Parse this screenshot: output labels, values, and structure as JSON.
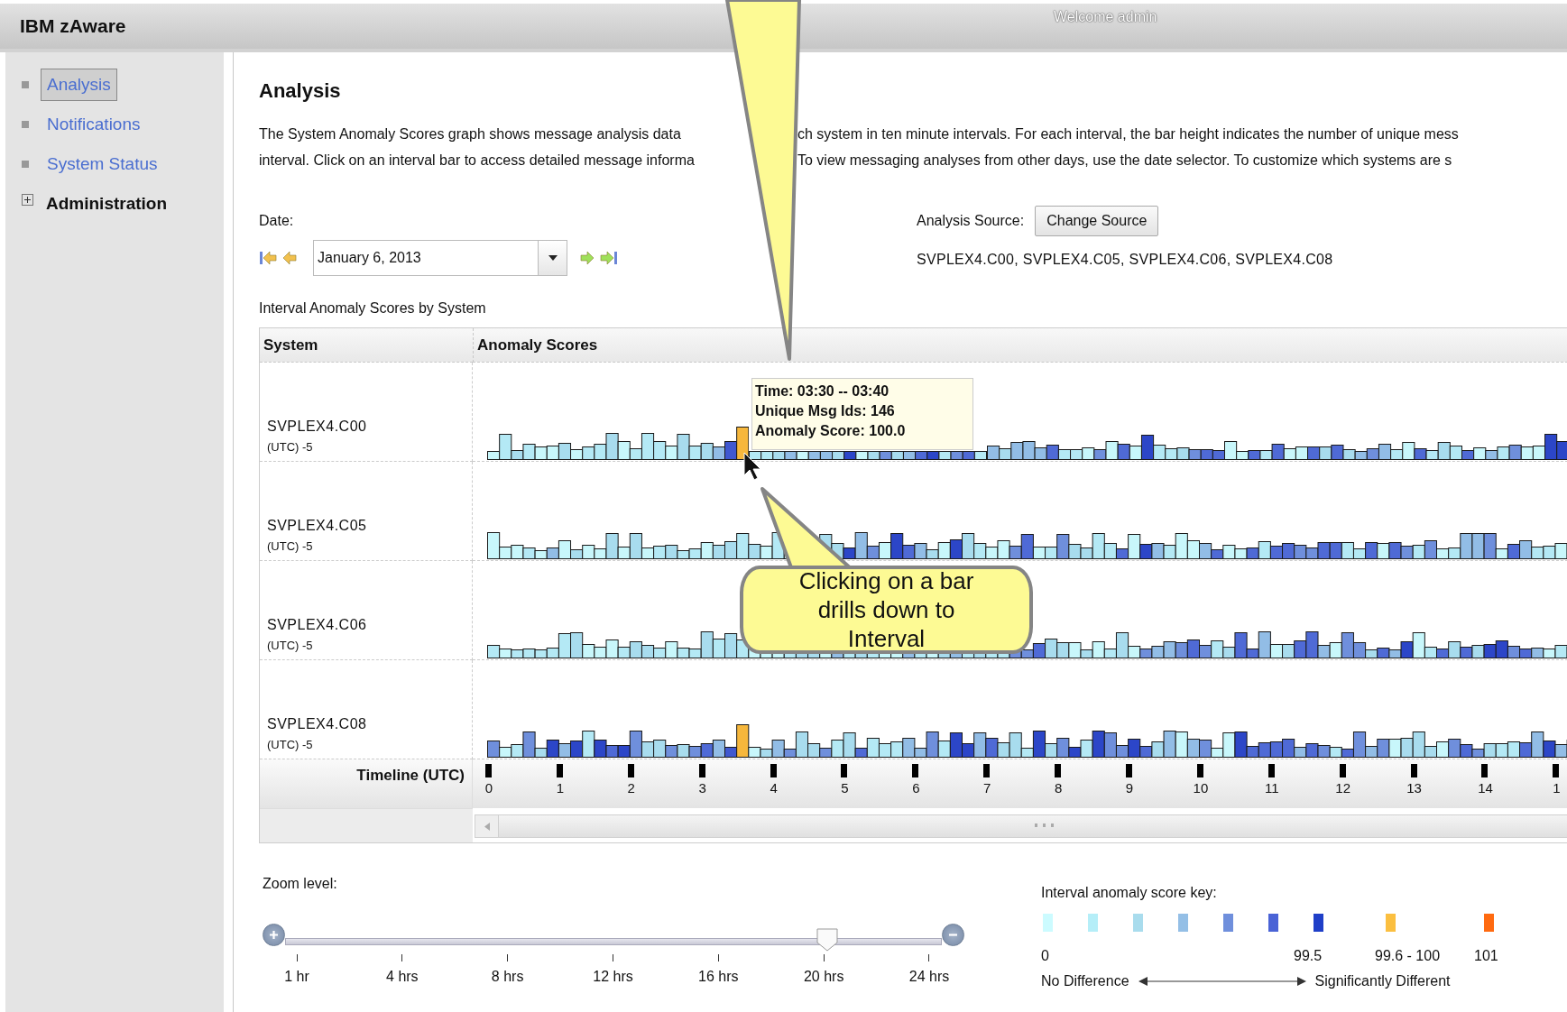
{
  "header": {
    "product": "IBM zAware",
    "welcome": "Welcome admin"
  },
  "sidebar": {
    "items": [
      {
        "label": "Analysis",
        "kind": "link",
        "selected": true
      },
      {
        "label": "Notifications",
        "kind": "link",
        "selected": false
      },
      {
        "label": "System Status",
        "kind": "link",
        "selected": false
      },
      {
        "label": "Administration",
        "kind": "group",
        "selected": false,
        "expanded": false
      }
    ]
  },
  "page": {
    "title": "Analysis",
    "description_lines": [
      {
        "before": "The System Anomaly Scores graph shows message analysis data",
        "after": "ch system in ten minute intervals. For each interval, the bar height indicates the number of unique mess"
      },
      {
        "before": "interval. Click on an interval bar to access detailed message informa",
        "after": "To view messaging analyses from other days, use the date selector. To customize which systems are s"
      }
    ]
  },
  "date": {
    "label": "Date:",
    "value": "January 6, 2013"
  },
  "source": {
    "label": "Analysis Source:",
    "button": "Change Source",
    "systems": "SVPLEX4.C00, SVPLEX4.C05, SVPLEX4.C06, SVPLEX4.C08"
  },
  "chart_table": {
    "title": "Interval Anomaly Scores by System",
    "columns": [
      "System",
      "Anomaly Scores"
    ],
    "rows": [
      {
        "system": "SVPLEX4.C00",
        "offset": "(UTC) -5"
      },
      {
        "system": "SVPLEX4.C05",
        "offset": "(UTC) -5"
      },
      {
        "system": "SVPLEX4.C06",
        "offset": "(UTC) -5"
      },
      {
        "system": "SVPLEX4.C08",
        "offset": "(UTC) -5"
      }
    ],
    "timeline_label": "Timeline (UTC)",
    "hours": [
      "0",
      "1",
      "2",
      "3",
      "4",
      "5",
      "6",
      "7",
      "8",
      "9",
      "10",
      "11",
      "12",
      "13",
      "14",
      "1"
    ]
  },
  "tooltip": {
    "lines": [
      "Time: 03:30 -- 03:40",
      "Unique Msg Ids: 146",
      "Anomaly Score: 100.0"
    ]
  },
  "callout": {
    "text": "Clicking on a bar drills down to Interval"
  },
  "zoom": {
    "label": "Zoom level:",
    "level": 0.83,
    "ticks": [
      "1 hr",
      "4 hrs",
      "8 hrs",
      "12 hrs",
      "16 hrs",
      "20 hrs",
      "24 hrs"
    ]
  },
  "score_key": {
    "title": "Interval anomaly score key:",
    "swatches": [
      {
        "color": "#ccfbff",
        "kind": "score"
      },
      {
        "color": "#b5eef8",
        "kind": "score"
      },
      {
        "color": "#a9dced",
        "kind": "score"
      },
      {
        "color": "#94bfe6",
        "kind": "score"
      },
      {
        "color": "#6f8fdc",
        "kind": "score"
      },
      {
        "color": "#4a63d6",
        "kind": "score"
      },
      {
        "color": "#1f3fc8",
        "kind": "score"
      },
      {
        "color": "#fbbf40",
        "kind": "warning"
      },
      {
        "color": "#ff6a10",
        "kind": "alert"
      }
    ],
    "min": "0",
    "max": "99.5",
    "warning": "99.6 - 100",
    "alert": "101",
    "left": "No Difference",
    "right": "Significantly Different"
  }
}
